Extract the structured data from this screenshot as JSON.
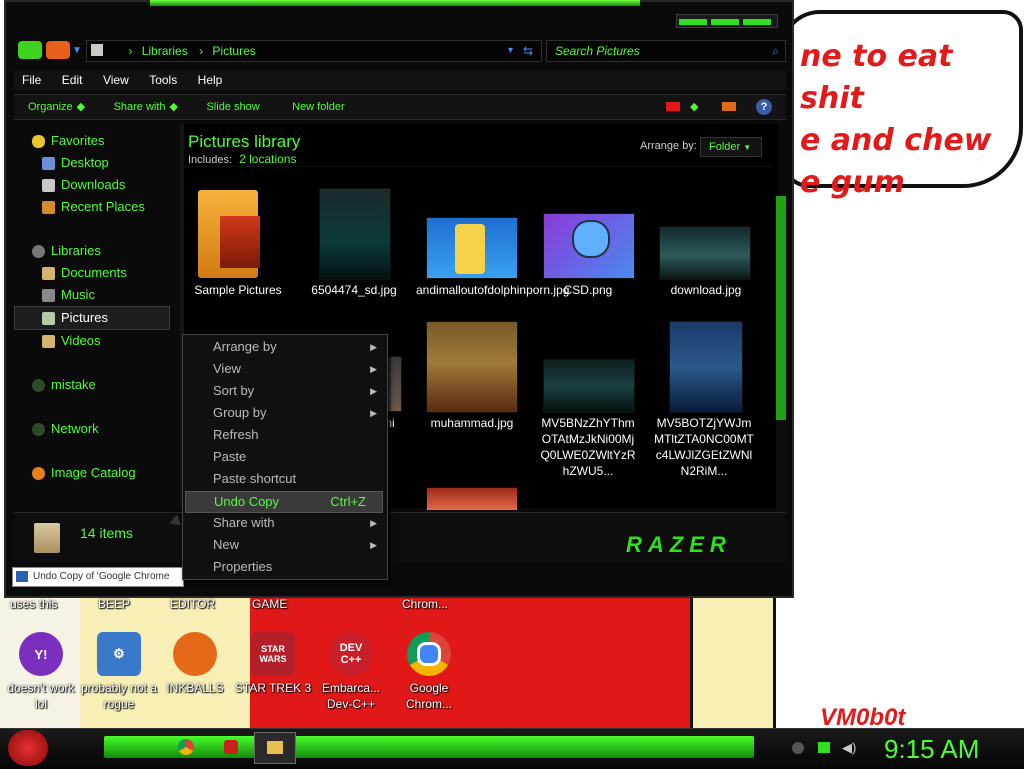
{
  "desktop": {
    "bubble_lines": [
      "ne to eat shit",
      "e and chew",
      "e gum"
    ],
    "signature": "VM0b0t",
    "partial_labels": [
      "uses this",
      "BEEP",
      "EDITOR",
      "GAME",
      "Chrom..."
    ],
    "icons": [
      {
        "name": "yahoo",
        "label": "doesn't work lol",
        "color": "#7b2fbe"
      },
      {
        "name": "rogue",
        "label": "probably not a rogue",
        "color": "#3a78c9"
      },
      {
        "name": "inkballs",
        "label": "INKBALLS",
        "color": "#e46a1a"
      },
      {
        "name": "startrek",
        "label": "STAR TREK 3",
        "color": "#b3202a"
      },
      {
        "name": "devcpp",
        "label": "Embarca... Dev-C++",
        "color": "#c8202a"
      },
      {
        "name": "chrome",
        "label": "Google Chrom...",
        "color": "#2c8a3a"
      }
    ]
  },
  "window": {
    "breadcrumb": [
      "Libraries",
      "Pictures"
    ],
    "search_placeholder": "Search Pictures",
    "menu": [
      "File",
      "Edit",
      "View",
      "Tools",
      "Help"
    ],
    "toolbar": [
      "Organize",
      "Share with",
      "Slide show",
      "New folder"
    ],
    "nav": {
      "favorites": "Favorites",
      "favorites_items": [
        "Desktop",
        "Downloads",
        "Recent Places"
      ],
      "libraries": "Libraries",
      "libraries_items": [
        "Documents",
        "Music",
        "Pictures",
        "Videos"
      ],
      "other": [
        "mistake",
        "Network",
        "Image Catalog"
      ]
    },
    "library_title": "Pictures library",
    "includes_label": "Includes:",
    "includes_value": "2 locations",
    "arrange_label": "Arrange by:",
    "arrange_value": "Folder",
    "files": [
      "Sample Pictures",
      "6504474_sd.jpg",
      "andimalloutofdolphinporn.jpg",
      "CSD.png",
      "download.jpg",
      "muhammad.jpg",
      "MV5BNzZhYThmOTAtMzJkNi00MjQ0LWE0ZWltYzRhZWU5...",
      "MV5BOTZjYWJmMTltZTA0NC00MTc4LWJlZGEtZWNlN2RiM..."
    ],
    "partial_file": "mi",
    "status_count": "14 items",
    "brand": "RAZER",
    "task_preview": "Undo Copy of 'Google Chrome"
  },
  "context_menu": {
    "items": [
      {
        "label": "Arrange by",
        "submenu": true
      },
      {
        "label": "View",
        "submenu": true
      },
      {
        "label": "Sort by",
        "submenu": true
      },
      {
        "label": "Group by",
        "submenu": true
      },
      {
        "label": "Refresh",
        "submenu": false
      },
      {
        "label": "Paste",
        "submenu": false
      },
      {
        "label": "Paste shortcut",
        "submenu": false
      },
      {
        "label": "Undo Copy",
        "shortcut": "Ctrl+Z",
        "highlighted": true
      },
      {
        "label": "Share with",
        "submenu": true
      },
      {
        "label": "New",
        "submenu": true
      },
      {
        "label": "Properties",
        "submenu": false
      }
    ]
  },
  "taskbar": {
    "clock": "9:15 AM"
  }
}
